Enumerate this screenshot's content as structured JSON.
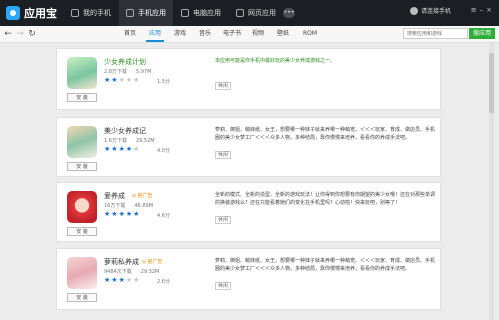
{
  "app": {
    "logo_text": "应用宝"
  },
  "nav": {
    "tabs": [
      {
        "label": "我的手机",
        "icon": "phone-icon"
      },
      {
        "label": "手机应用",
        "icon": "apps-icon"
      },
      {
        "label": "电脑应用",
        "icon": "monitor-icon"
      },
      {
        "label": "网页应用",
        "icon": "web-icon"
      }
    ],
    "active_tab": 1,
    "badge": "•••"
  },
  "user": {
    "label": "请连接手机"
  },
  "subnav": {
    "tabs": [
      "首页",
      "应用",
      "游戏",
      "音乐",
      "电子书",
      "视频",
      "壁纸",
      "ROM"
    ],
    "active_tab": 1
  },
  "search": {
    "placeholder": "搜索应用和游戏",
    "button": "搜应用"
  },
  "accent_colors": {
    "primary": "#1a8ad9",
    "success": "#2fae3a",
    "star": "#1a6ed8",
    "ad": "#f08a00"
  },
  "apps": [
    {
      "name": "少女养成计划",
      "ad": "",
      "downloads": "2.8万下载",
      "size": "5.97M",
      "rating": 1.5,
      "score": "1.5分",
      "description": "本应用可能是你手机中最好玩的美少女养成游戏之一。",
      "install": "安 装",
      "tag": "休闲"
    },
    {
      "name": "美少女养成记",
      "ad": "",
      "downloads": "1.6万下载",
      "size": "29.52M",
      "rating": 4.0,
      "score": "4.0分",
      "description": "萝莉、御姐、萌妹纸、女王，想要哪一种妹子就来养哪一种萌宠。＜＜＜玩家、育成、做店员、手机圈的美少女梦工厂＜＜＜众多人物，多种结局，靠你慢慢来培养，看看你的养成手法吧。",
      "install": "安 装",
      "tag": "休闲"
    },
    {
      "name": "爱养成",
      "ad": "官广告",
      "downloads": "16万下载",
      "size": "46.89M",
      "rating": 4.6,
      "score": "4.6分",
      "description": "全新的模式、全新的造型、全新的游戏玩法！让你得到你想要有你期望的美少女哦！还在对那些单调的换装游戏么？还在只能看着她们的变化在手机里吗？心动啦！快来玩吧，别等了！",
      "install": "安 装",
      "tag": "休闲"
    },
    {
      "name": "萝莉私养成",
      "ad": "官广告",
      "downloads": "9484次下载",
      "size": "29.32M",
      "rating": 2.6,
      "score": "2.6分",
      "description": "萝莉、御姐、萌妹纸、女王，想要哪一种妹子就来养哪一种萌宠。＜＜＜玩家、育成、做店员、手机圈的美少女梦工厂＜＜＜众多人物，多种结局，靠你慢慢来培养，看看你的养成手法吧。",
      "install": "安 装",
      "tag": "休闲"
    }
  ]
}
